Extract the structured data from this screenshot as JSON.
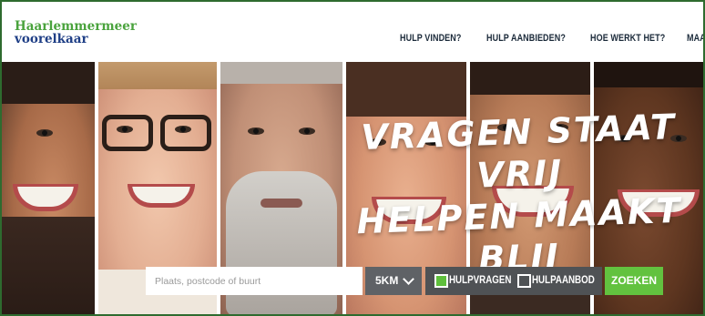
{
  "brand": {
    "line1": "Haarlemmermeer",
    "line2": "voorelkaar",
    "colors": {
      "line1": "#4aa33d",
      "line2": "#1f3f86"
    }
  },
  "nav": {
    "items": [
      {
        "label": "HULP VINDEN?"
      },
      {
        "label": "HULP AANBIEDEN?"
      },
      {
        "label": "HOE WERKT HET?"
      },
      {
        "label": "MAAT"
      }
    ]
  },
  "hero": {
    "headline": [
      "VRAGEN STAAT VRIJ",
      "HELPEN MAAKT",
      "BLIJ"
    ]
  },
  "search": {
    "placeholder": "Plaats, postcode of buurt",
    "value": "",
    "radius": "5KM",
    "filters": [
      {
        "label": "HULPVRAGEN",
        "checked": true
      },
      {
        "label": "HULPAANBOD",
        "checked": false
      }
    ],
    "submit_label": "ZOEKEN",
    "colors": {
      "accent": "#62c23f",
      "filter_bg": "#4f5255",
      "radius_bg": "#5f6266"
    }
  },
  "icons": {
    "radius_dropdown": "chevron-down-icon"
  }
}
